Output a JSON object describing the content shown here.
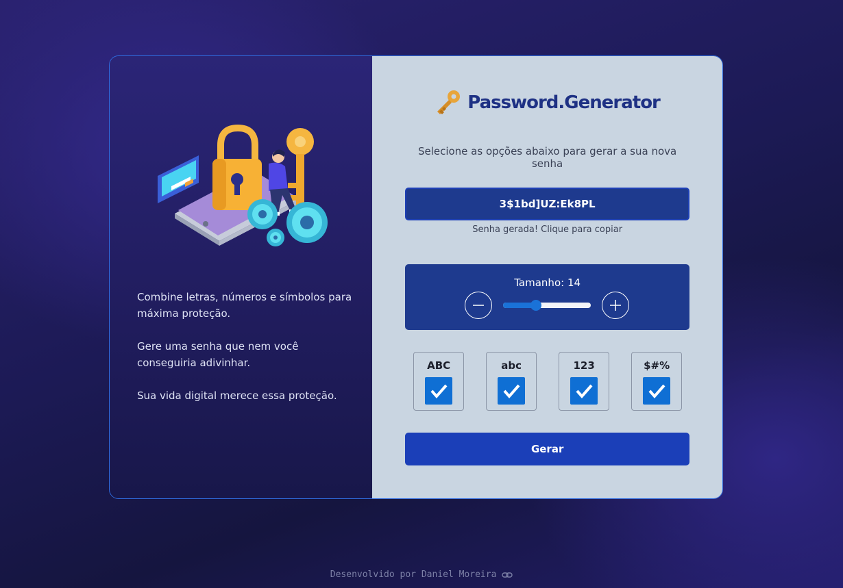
{
  "brand": {
    "title": "Password.Generator",
    "icon": "key-icon"
  },
  "left_panel": {
    "illustration": "security-illustration",
    "paragraphs": [
      "Combine letras, números e símbolos para máxima proteção.",
      "Gere uma senha que nem você conseguiria adivinhar.",
      "Sua vida digital merece essa proteção."
    ]
  },
  "main": {
    "subtitle": "Selecione as opções abaixo para gerar a sua nova senha",
    "password": "3$1bd]UZ:Ek8PL",
    "copy_hint": "Senha gerada! Clique para copiar",
    "size": {
      "label": "Tamanho: 14",
      "value": 14,
      "slider_fraction": 0.37
    },
    "options": [
      {
        "label": "ABC",
        "checked": true
      },
      {
        "label": "abc",
        "checked": true
      },
      {
        "label": "123",
        "checked": true
      },
      {
        "label": "$#%",
        "checked": true
      }
    ],
    "generate_label": "Gerar"
  },
  "footer": {
    "text": "Desenvolvido por Daniel Moreira",
    "icon": "link-icon"
  },
  "colors": {
    "accent": "#1e3a8e",
    "button": "#1b3fb8",
    "checkbox": "#0f6fd4",
    "panel_bg": "#c9d5e1",
    "title": "#1e3184"
  }
}
